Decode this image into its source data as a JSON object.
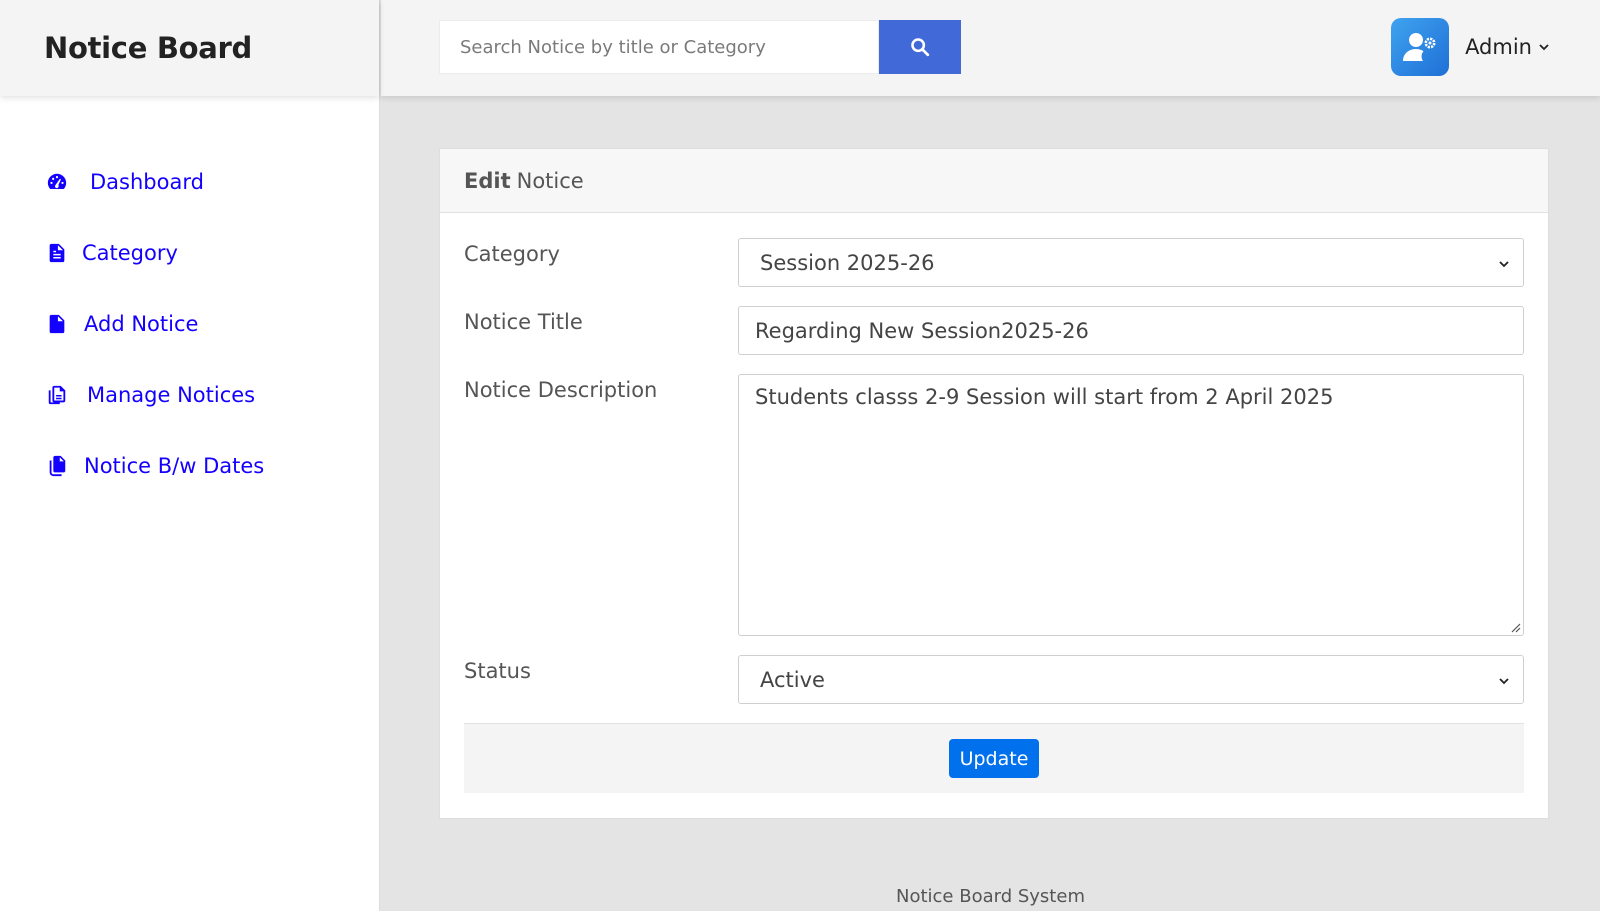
{
  "brand": {
    "title": "Notice Board"
  },
  "sidebar": {
    "items": [
      {
        "label": "Dashboard",
        "icon": "dashboard-icon"
      },
      {
        "label": "Category",
        "icon": "file-text-icon"
      },
      {
        "label": "Add Notice",
        "icon": "file-icon"
      },
      {
        "label": "Manage Notices",
        "icon": "copy-icon"
      },
      {
        "label": "Notice B/w Dates",
        "icon": "files-icon"
      }
    ]
  },
  "header": {
    "search_placeholder": "Search Notice by title or Category",
    "search_value": "",
    "user_name": "Admin"
  },
  "form": {
    "header_bold": "Edit",
    "header_rest": "Notice",
    "category_label": "Category",
    "category_value": "Session 2025-26",
    "title_label": "Notice Title",
    "title_value": "Regarding New Session2025-26",
    "description_label": "Notice Description",
    "description_value": "Students classs 2-9 Session will start from 2 April 2025",
    "status_label": "Status",
    "status_value": "Active",
    "submit_label": "Update"
  },
  "footer": {
    "text": "Notice Board System"
  },
  "colors": {
    "nav_link": "#1400ff",
    "search_button": "#4169d8",
    "update_button": "#0070ec"
  }
}
